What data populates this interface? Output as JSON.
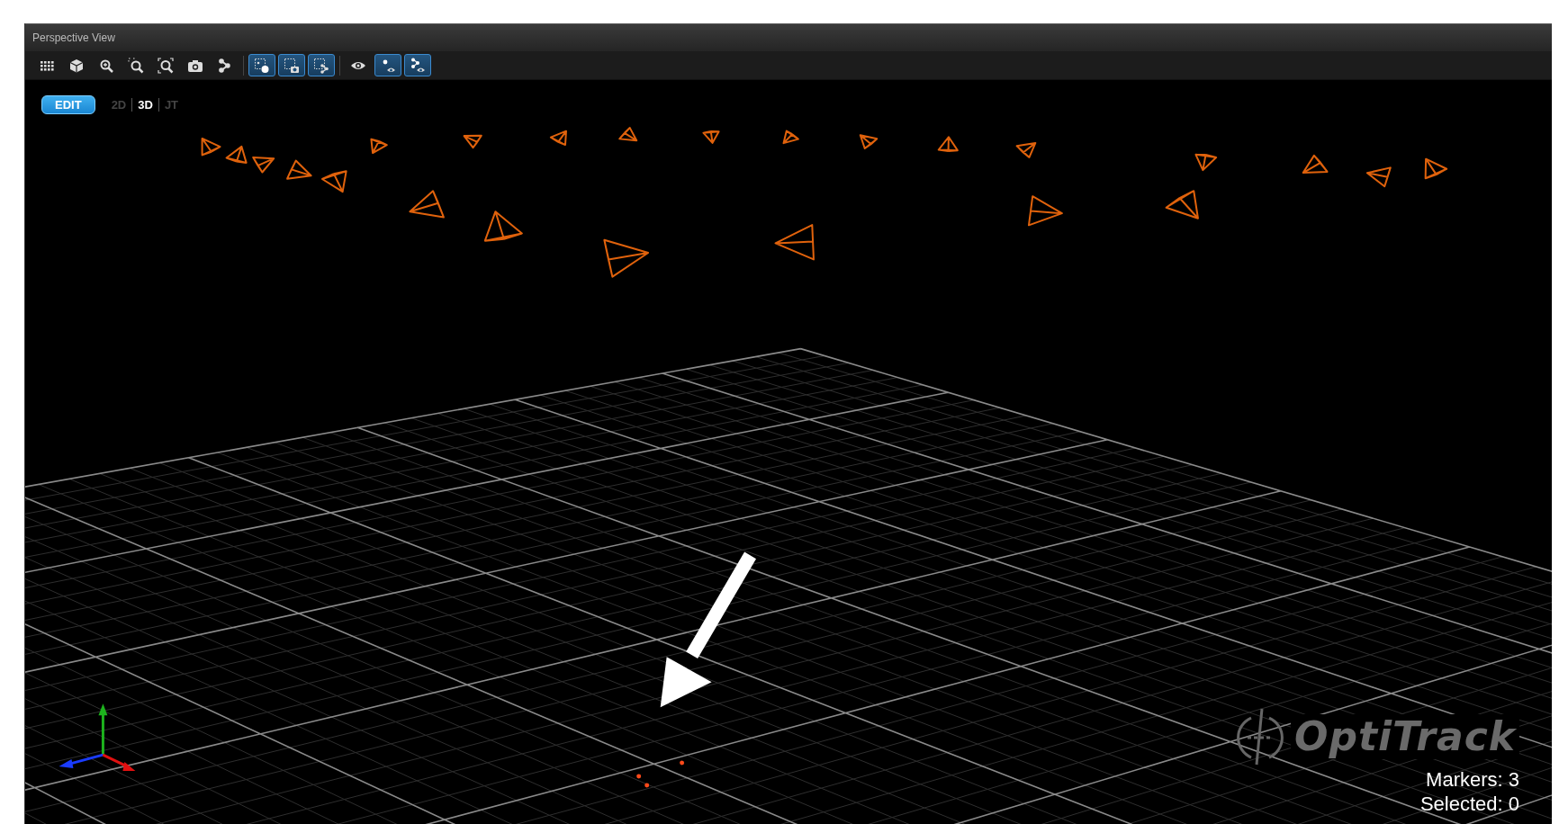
{
  "window": {
    "title": "Perspective View"
  },
  "toolbar": [
    {
      "kind": "grid",
      "on": false
    },
    {
      "kind": "cube",
      "on": false
    },
    {
      "kind": "zoom",
      "on": false
    },
    {
      "kind": "zoom-box",
      "on": false
    },
    {
      "kind": "zoom-fit",
      "on": false
    },
    {
      "kind": "camera",
      "on": false
    },
    {
      "kind": "nodes",
      "on": false
    },
    {
      "kind": "select-dot",
      "on": true
    },
    {
      "kind": "select-camera",
      "on": true
    },
    {
      "kind": "select-nodes",
      "on": true
    },
    {
      "kind": "eye",
      "on": false
    },
    {
      "kind": "show-dots",
      "on": true
    },
    {
      "kind": "show-nodes",
      "on": true
    }
  ],
  "mode_button": {
    "label": "EDIT",
    "on": true
  },
  "view_tabs": [
    {
      "label": "2D",
      "selected": false
    },
    {
      "label": "3D",
      "selected": true
    },
    {
      "label": "JT",
      "selected": false
    }
  ],
  "logo": {
    "text": "OptiTrack"
  },
  "status": [
    "Markers: 3",
    "Selected: 0"
  ]
}
